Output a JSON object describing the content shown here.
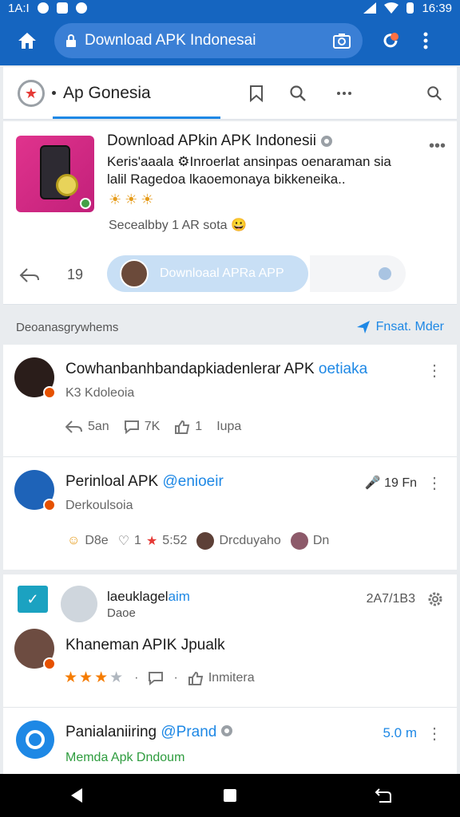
{
  "status_bar": {
    "time_left": "1A:I",
    "time_right": "16:39"
  },
  "browser": {
    "url": "Download APK Indonesai"
  },
  "app_bar": {
    "title": "Ap Gonesia"
  },
  "hero": {
    "title": "Download APkin APK Indonesii",
    "description": "Keris'aaala ⚙Inroerlat ansinpas oenaraman sia lalil Ragedoa lkaoemonaya bikkeneika..",
    "meta": "Secealbby 1 AR sota 😀",
    "count": "19",
    "download_label": "Downloaal APRa APP"
  },
  "section": {
    "title": "Deoanasgrywhems",
    "featured_label": "Fnsat. Mder"
  },
  "posts": [
    {
      "title": "Cowhanbanhbandapkiadenlerar APK",
      "title_highlight": "oetiaka",
      "subtitle": "K3 Kdoleoia",
      "share": "5an",
      "comments": "7K",
      "likes": "1",
      "extra": "Iupa"
    },
    {
      "title": "Perinloal APK",
      "title_highlight": "@enioeir",
      "subtitle": "Derkoulsoia",
      "time": "19 Fn",
      "a1": "D8e",
      "a2": "1",
      "a3": "5:52",
      "a4": "Drcduyaho",
      "a5": "Dn"
    }
  ],
  "review_header": {
    "name": "laeuklagel",
    "name_highlight": "aim",
    "sub": "Daoe",
    "date": "2A7/1B3"
  },
  "review_2": {
    "title": "Khaneman APIK Jpualk",
    "rating": 3,
    "rating_max": 5,
    "reply_label": "Inmitera"
  },
  "review_3": {
    "title": "Panialaniiring",
    "title_highlight": "@Prand",
    "subtitle": "Memda Apk Dndoum",
    "time": "5.0 m"
  },
  "colors": {
    "primary": "#1565c0",
    "accent": "#1e88e5",
    "star": "#f57c00"
  }
}
